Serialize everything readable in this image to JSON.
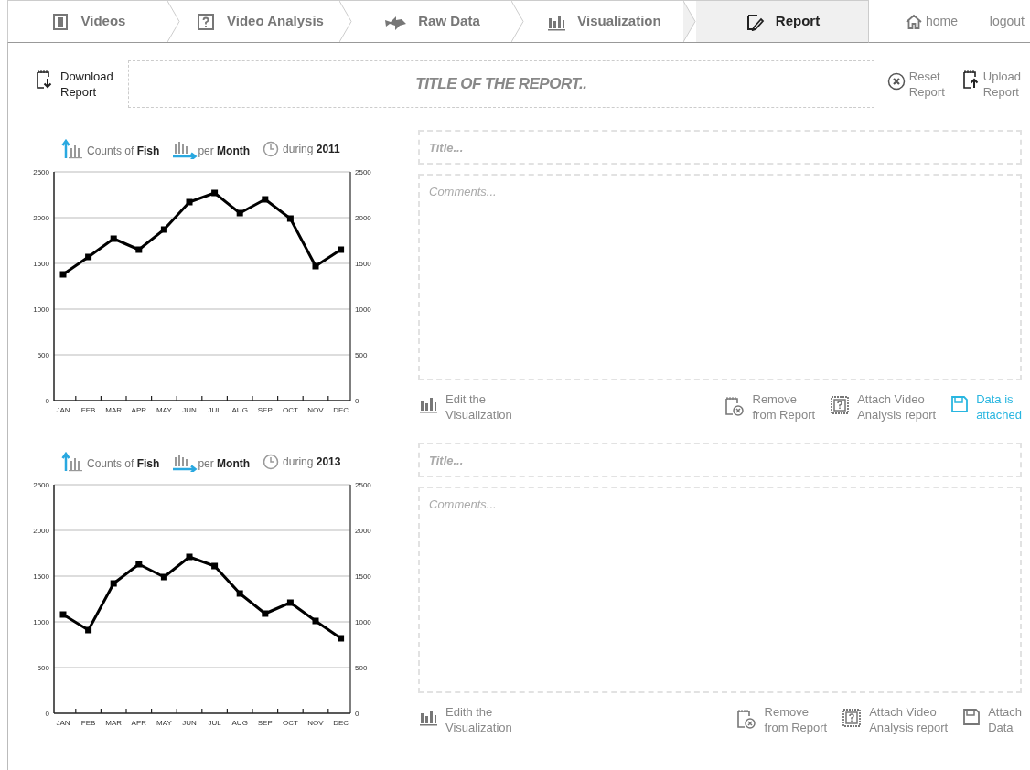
{
  "nav": {
    "tabs": [
      {
        "label": "Videos",
        "selected": false
      },
      {
        "label": "Video Analysis",
        "selected": false
      },
      {
        "label": "Raw Data",
        "selected": false
      },
      {
        "label": "Visualization",
        "selected": false
      },
      {
        "label": "Report",
        "selected": true
      }
    ],
    "links": [
      {
        "label": "home"
      },
      {
        "label": "logout"
      }
    ]
  },
  "toolbar": {
    "download": [
      "Download",
      "Report"
    ],
    "title_placeholder": "TITLE OF THE REPORT..",
    "reset": [
      "Reset",
      "Report"
    ],
    "upload": [
      "Upload",
      "Report"
    ]
  },
  "sections": [
    {
      "header": {
        "measure": "Counts of **Fish**",
        "unit": "per **Month**",
        "period": "during **2011**"
      },
      "chart_data": {
        "type": "line",
        "categories": [
          "JAN",
          "FEB",
          "MAR",
          "APR",
          "MAY",
          "JUN",
          "JUL",
          "AUG",
          "SEP",
          "OCT",
          "NOV",
          "DEC"
        ],
        "series": [
          {
            "color": "#000000",
            "marker": "square",
            "values": [
              1380,
              1570,
              1770,
              1650,
              1870,
              2170,
              2270,
              2050,
              2200,
              1990,
              1470,
              1650
            ]
          }
        ],
        "ylim": [
          0,
          2500
        ],
        "yticks": [
          0,
          500,
          1000,
          1500,
          2000,
          2500
        ],
        "grid": true
      },
      "right_axis_labels": [
        "2500",
        "2000",
        "1500",
        "1000",
        "500",
        "0"
      ],
      "title_placeholder": "Title...",
      "comments_placeholder": "Comments...",
      "actions": [
        {
          "kind": "edit",
          "lines": [
            "Edit the",
            "Visualization"
          ]
        },
        {
          "kind": "remove",
          "lines": [
            "Remove",
            "from Report"
          ]
        },
        {
          "kind": "attach-video",
          "lines": [
            "Attach Video",
            "Analysis report"
          ]
        },
        {
          "kind": "attach-data",
          "lines": [
            "Data is",
            "attached"
          ],
          "attached": true
        }
      ]
    },
    {
      "header": {
        "measure": "Counts of **Fish**",
        "unit": "per **Month**",
        "period": "during **2013**"
      },
      "chart_data": {
        "type": "line",
        "categories": [
          "JAN",
          "FEB",
          "MAR",
          "APR",
          "MAY",
          "JUN",
          "JUL",
          "AUG",
          "SEP",
          "OCT",
          "NOV",
          "DEC"
        ],
        "series": [
          {
            "color": "#000000",
            "marker": "square",
            "values": [
              1080,
              910,
              1420,
              1630,
              1490,
              1710,
              1610,
              1310,
              1090,
              1210,
              1010,
              820
            ]
          }
        ],
        "ylim": [
          0,
          2500
        ],
        "yticks": [
          0,
          500,
          1000,
          1500,
          2000,
          2500
        ],
        "grid": true
      },
      "right_axis_labels": [
        "2500",
        "2000",
        "1500",
        "1000",
        "500",
        "0"
      ],
      "title_placeholder": "Title...",
      "comments_placeholder": "Comments...",
      "actions": [
        {
          "kind": "edit",
          "lines": [
            "Edith the",
            "Visualization"
          ]
        },
        {
          "kind": "remove",
          "lines": [
            "Remove",
            "from Report"
          ]
        },
        {
          "kind": "attach-video",
          "lines": [
            "Attach Video",
            "Analysis report"
          ]
        },
        {
          "kind": "attach-data",
          "lines": [
            "Attach",
            "Data"
          ],
          "attached": false
        }
      ]
    }
  ]
}
